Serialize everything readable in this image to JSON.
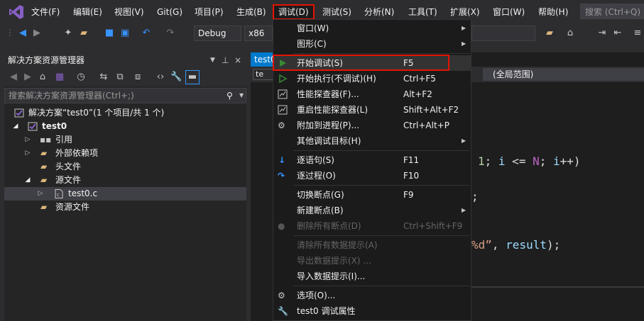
{
  "menubar": {
    "items": [
      "文件(F)",
      "编辑(E)",
      "视图(V)",
      "Git(G)",
      "项目(P)",
      "生成(B)",
      "调试(D)",
      "测试(S)",
      "分析(N)",
      "工具(T)",
      "扩展(X)",
      "窗口(W)",
      "帮助(H)"
    ],
    "search_placeholder": "搜索 (Ctrl+Q)"
  },
  "toolbar": {
    "config": "Debug",
    "platform": "x86"
  },
  "solution_explorer": {
    "title": "解决方案资源管理器",
    "search_placeholder": "搜索解决方案资源管理器(Ctrl+;)",
    "tree": [
      {
        "label": "解决方案“test0”(1 个项目/共 1 个)"
      },
      {
        "label": "test0"
      },
      {
        "label": "引用"
      },
      {
        "label": "外部依赖项"
      },
      {
        "label": "头文件"
      },
      {
        "label": "源文件"
      },
      {
        "label": "test0.c"
      },
      {
        "label": "资源文件"
      }
    ]
  },
  "editor": {
    "tab": "test0",
    "nav_tab": "te",
    "scope": "(全局范围)",
    "code_lines": [
      "1; i <= N; i++)",
      ";",
      "%d\", result);"
    ]
  },
  "debug_menu": {
    "items": [
      {
        "label": "窗口(W)",
        "shortcut": ""
      },
      {
        "label": "图形(C)",
        "shortcut": ""
      },
      {
        "label": "开始调试(S)",
        "shortcut": "F5"
      },
      {
        "label": "开始执行(不调试)(H)",
        "shortcut": "Ctrl+F5"
      },
      {
        "label": "性能探查器(F)...",
        "shortcut": "Alt+F2"
      },
      {
        "label": "重启性能探查器(L)",
        "shortcut": "Shift+Alt+F2"
      },
      {
        "label": "附加到进程(P)...",
        "shortcut": "Ctrl+Alt+P"
      },
      {
        "label": "其他调试目标(H)",
        "shortcut": ""
      },
      {
        "label": "逐语句(S)",
        "shortcut": "F11"
      },
      {
        "label": "逐过程(O)",
        "shortcut": "F10"
      },
      {
        "label": "切换断点(G)",
        "shortcut": "F9"
      },
      {
        "label": "新建断点(B)",
        "shortcut": ""
      },
      {
        "label": "删除所有断点(D)",
        "shortcut": "Ctrl+Shift+F9"
      },
      {
        "label": "清除所有数据提示(A)",
        "shortcut": ""
      },
      {
        "label": "导出数据提示(X) ...",
        "shortcut": ""
      },
      {
        "label": "导入数据提示(I)...",
        "shortcut": ""
      },
      {
        "label": "选项(O)...",
        "shortcut": ""
      },
      {
        "label": "test0 调试属性",
        "shortcut": ""
      }
    ]
  },
  "colors": {
    "accent": "#007acc",
    "highlight_border": "#e51400",
    "play_green": "#388a34",
    "vs_purple": "#865fc5"
  }
}
